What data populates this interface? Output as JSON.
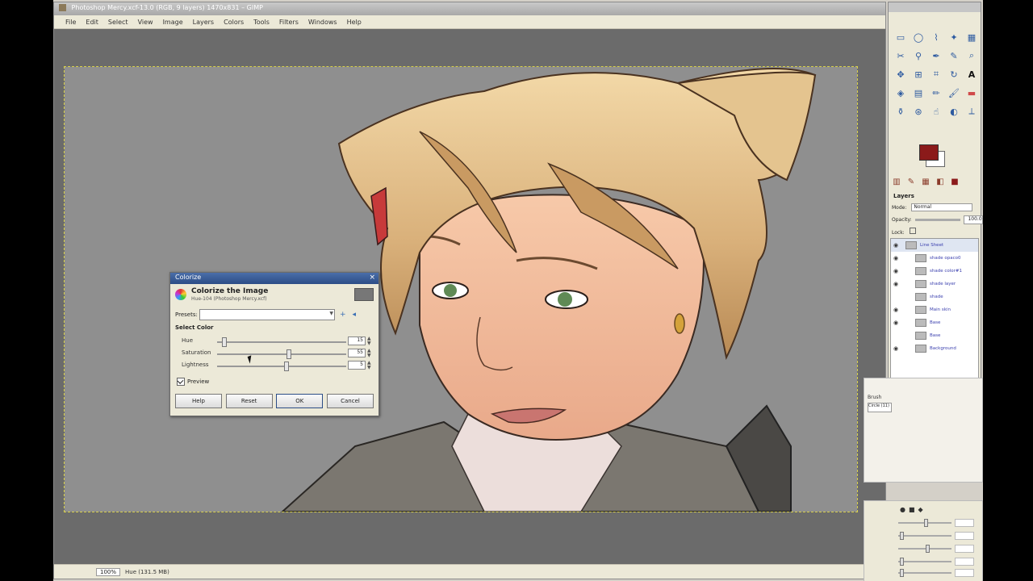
{
  "window": {
    "title": "Photoshop Mercy.xcf-13.0 (RGB, 9 layers) 1470x831 – GIMP"
  },
  "menubar": [
    "File",
    "Edit",
    "Select",
    "View",
    "Image",
    "Layers",
    "Colors",
    "Tools",
    "Filters",
    "Windows",
    "Help"
  ],
  "statusbar": {
    "zoom": "100%",
    "info": "Hue (131.5 MB)"
  },
  "dialog": {
    "title": "Colorize",
    "heading": "Colorize the Image",
    "subheading": "Hue-104 (Photoshop Mercy.xcf)",
    "presets_label": "Presets:",
    "presets_value": "",
    "section_label": "Select Color",
    "sliders": [
      {
        "label": "Hue",
        "value": "15",
        "fraction": 0.05
      },
      {
        "label": "Saturation",
        "value": "55",
        "fraction": 0.55
      },
      {
        "label": "Lightness",
        "value": "5",
        "fraction": 0.53
      }
    ],
    "preview_label": "Preview",
    "preview_checked": true,
    "buttons": {
      "help": "Help",
      "reset": "Reset",
      "ok": "OK",
      "cancel": "Cancel"
    }
  },
  "toolbox": {
    "fg_color": "#8b1a1a",
    "bg_color": "#ffffff",
    "layers_label": "Layers",
    "mode_label": "Mode:",
    "mode_value": "Normal",
    "opacity_label": "Opacity:",
    "opacity_value": "100.0",
    "lock_label": "Lock:",
    "layers": [
      {
        "name": "Line Sheet",
        "group": true
      },
      {
        "name": "shade opaco0",
        "group": false
      },
      {
        "name": "shade color#1",
        "group": false
      },
      {
        "name": "shade layer",
        "group": false
      },
      {
        "name": "shade",
        "group": false
      },
      {
        "name": "Main skin",
        "group": false
      },
      {
        "name": "Base",
        "group": false
      },
      {
        "name": "Base",
        "group": false
      },
      {
        "name": "Background",
        "group": false
      }
    ]
  },
  "brush_dock": {
    "label": "Brush",
    "box": "Circle (11)"
  }
}
